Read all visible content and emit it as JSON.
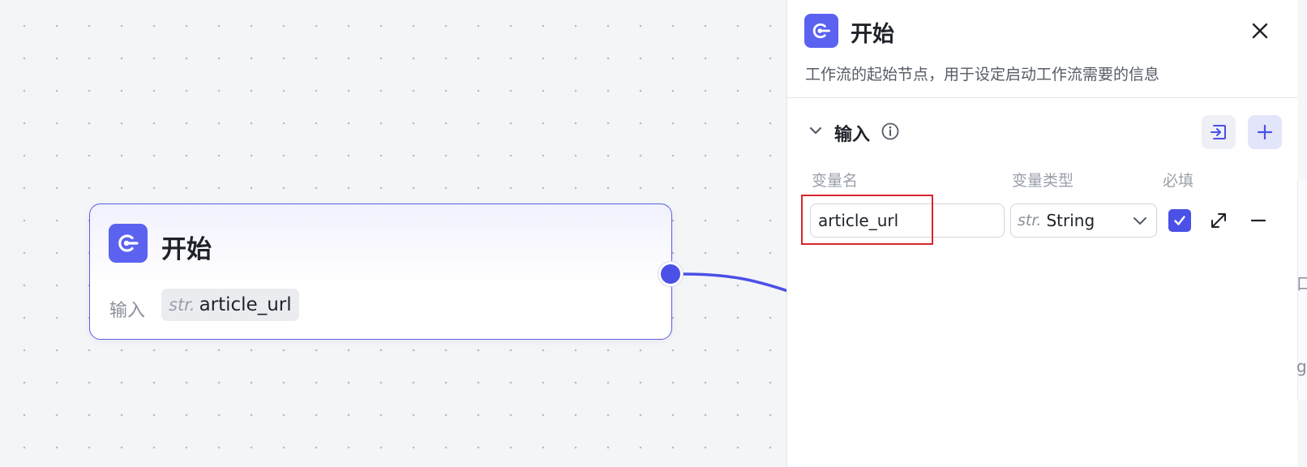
{
  "node": {
    "title": "开始",
    "input_label": "输入",
    "tag_type": "str.",
    "tag_name": "article_url"
  },
  "panel": {
    "title": "开始",
    "description": "工作流的起始节点，用于设定启动工作流需要的信息",
    "section_title": "输入",
    "columns": {
      "name": "变量名",
      "type": "变量类型",
      "required": "必填"
    },
    "variable": {
      "name": "article_url",
      "type_prefix": "str.",
      "type": "String",
      "required": true
    }
  },
  "background_fragments": [
    "口",
    "g"
  ],
  "colors": {
    "accent": "#4b50e6",
    "node_icon": "#5b62f0",
    "highlight": "#d9262c",
    "edge": "#4b50e6"
  },
  "icons": [
    "workflow-start-icon",
    "close-icon",
    "chevron-down-icon",
    "info-icon",
    "import-icon",
    "plus-icon",
    "chevron-down-icon",
    "check-icon",
    "expand-icon",
    "minus-icon"
  ]
}
